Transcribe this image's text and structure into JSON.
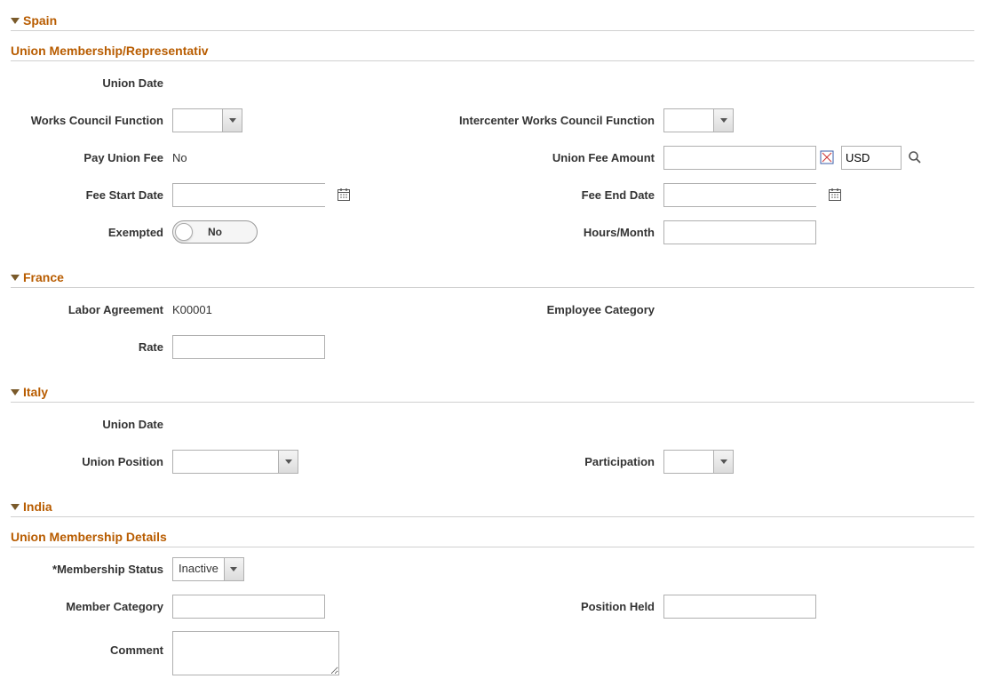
{
  "sections": {
    "spain": {
      "title": "Spain",
      "subsection_title": "Union Membership/Representativ",
      "labels": {
        "union_date": "Union Date",
        "works_council": "Works Council Function",
        "intercenter": "Intercenter Works Council Function",
        "pay_union_fee": "Pay Union Fee",
        "union_fee_amount": "Union Fee Amount",
        "fee_start": "Fee Start Date",
        "fee_end": "Fee End Date",
        "exempted": "Exempted",
        "hours_month": "Hours/Month"
      },
      "values": {
        "union_date": "",
        "works_council": "",
        "intercenter": "",
        "pay_union_fee": "No",
        "union_fee_amount": "",
        "currency": "USD",
        "fee_start": "",
        "fee_end": "",
        "exempted_toggle": "No",
        "hours_month": ""
      }
    },
    "france": {
      "title": "France",
      "labels": {
        "labor_agreement": "Labor Agreement",
        "employee_category": "Employee Category",
        "rate": "Rate"
      },
      "values": {
        "labor_agreement": "K00001",
        "employee_category": "",
        "rate": ""
      }
    },
    "italy": {
      "title": "Italy",
      "labels": {
        "union_date": "Union Date",
        "union_position": "Union Position",
        "participation": "Participation"
      },
      "values": {
        "union_date": "",
        "union_position": "",
        "participation": ""
      }
    },
    "india": {
      "title": "India",
      "subsection_title": "Union Membership Details",
      "labels": {
        "membership_status": "*Membership Status",
        "member_category": "Member Category",
        "position_held": "Position Held",
        "comment": "Comment"
      },
      "values": {
        "membership_status": "Inactive",
        "member_category": "",
        "position_held": "",
        "comment": ""
      }
    }
  }
}
